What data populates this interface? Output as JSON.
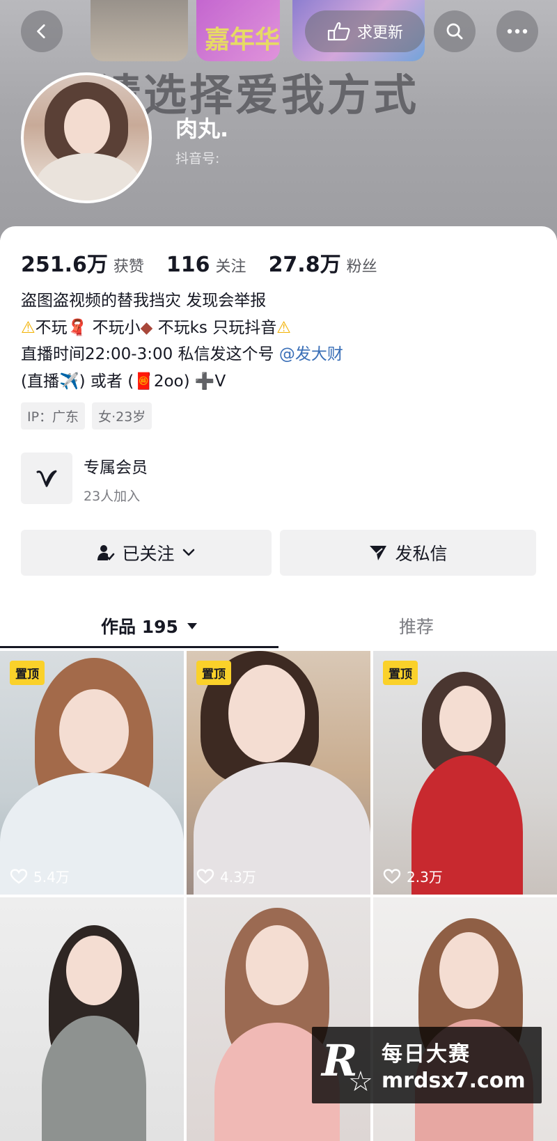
{
  "header": {
    "banner_text": "请选择爱我方式",
    "banner_badge": "嘉年华",
    "update_label": "求更新"
  },
  "profile": {
    "username": "肉丸.",
    "douyin_id_label": "抖音号:"
  },
  "stats": [
    {
      "value": "251.6万",
      "label": "获赞"
    },
    {
      "value": "116",
      "label": "关注"
    },
    {
      "value": "27.8万",
      "label": "粉丝"
    }
  ],
  "bio": {
    "line1": "盗图盗视频的替我挡灾 发现会举报",
    "line2_a": "不玩",
    "line2_b": " 不玩小",
    "line2_c": " 不玩ks 只玩抖音",
    "line3_text": "直播时间22:00-3:00 私信发这个号 ",
    "line3_mention": "@发大财",
    "line4": "(直播✈️) 或者 (🧧2oo) ➕V"
  },
  "tags": [
    "IP：广东",
    "女·23岁"
  ],
  "member": {
    "title": "专属会员",
    "subtitle": "23人加入"
  },
  "actions": {
    "follow_label": "已关注",
    "message_label": "发私信"
  },
  "tabs": {
    "works_label": "作品 195",
    "recommend_label": "推荐"
  },
  "videos": [
    {
      "pinned": "置顶",
      "likes": "5.4万"
    },
    {
      "pinned": "置顶",
      "likes": "4.3万"
    },
    {
      "pinned": "置顶",
      "likes": "2.3万"
    },
    {
      "pinned": "",
      "likes": ""
    },
    {
      "pinned": "",
      "likes": ""
    },
    {
      "pinned": "",
      "likes": ""
    }
  ],
  "watermark": {
    "logo": "R",
    "title": "每日大赛",
    "url": "mrdsx7.com"
  },
  "colors": {
    "accent_mention": "#3a6fb7",
    "pin_badge": "#fad12a",
    "button_bg": "#f1f1f2"
  }
}
